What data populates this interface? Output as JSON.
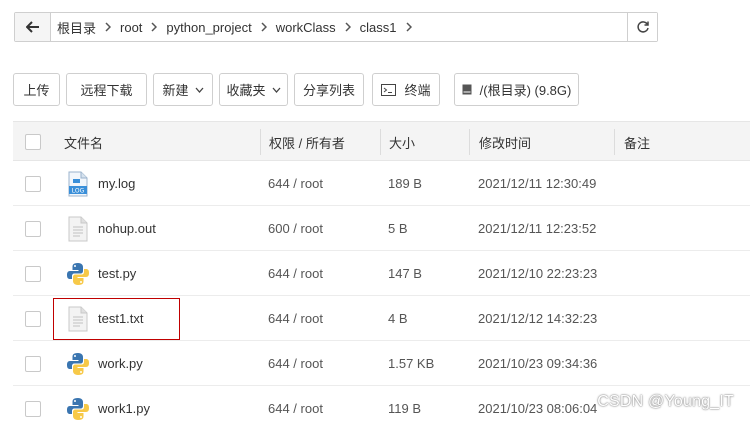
{
  "breadcrumb": {
    "items": [
      "根目录",
      "root",
      "python_project",
      "workClass",
      "class1"
    ]
  },
  "toolbar": {
    "upload": "上传",
    "remote_download": "远程下载",
    "new": "新建",
    "favorites": "收藏夹",
    "share_list": "分享列表",
    "terminal": "终端",
    "disk": "/(根目录) (9.8G)"
  },
  "table": {
    "headers": {
      "name": "文件名",
      "permission": "权限 / 所有者",
      "size": "大小",
      "modified": "修改时间",
      "note": "备注"
    },
    "rows": [
      {
        "name": "my.log",
        "permission": "644 / root",
        "size": "189 B",
        "modified": "2021/12/11 12:30:49",
        "icon": "log-file-icon"
      },
      {
        "name": "nohup.out",
        "permission": "600 / root",
        "size": "5 B",
        "modified": "2021/12/11 12:23:52",
        "icon": "text-file-icon"
      },
      {
        "name": "test.py",
        "permission": "644 / root",
        "size": "147 B",
        "modified": "2021/12/10 22:23:23",
        "icon": "python-file-icon"
      },
      {
        "name": "test1.txt",
        "permission": "644 / root",
        "size": "4 B",
        "modified": "2021/12/12 14:32:23",
        "icon": "text-file-icon"
      },
      {
        "name": "work.py",
        "permission": "644 / root",
        "size": "1.57 KB",
        "modified": "2021/10/23 09:34:36",
        "icon": "python-file-icon"
      },
      {
        "name": "work1.py",
        "permission": "644 / root",
        "size": "119 B",
        "modified": "2021/10/23 08:06:04",
        "icon": "python-file-icon"
      }
    ]
  },
  "watermark": "CSDN @Young_IT",
  "colors": {
    "highlight_border": "#c00000",
    "python_blue": "#3a75b0",
    "python_yellow": "#f7c948",
    "log_blue": "#3a8fd9"
  }
}
